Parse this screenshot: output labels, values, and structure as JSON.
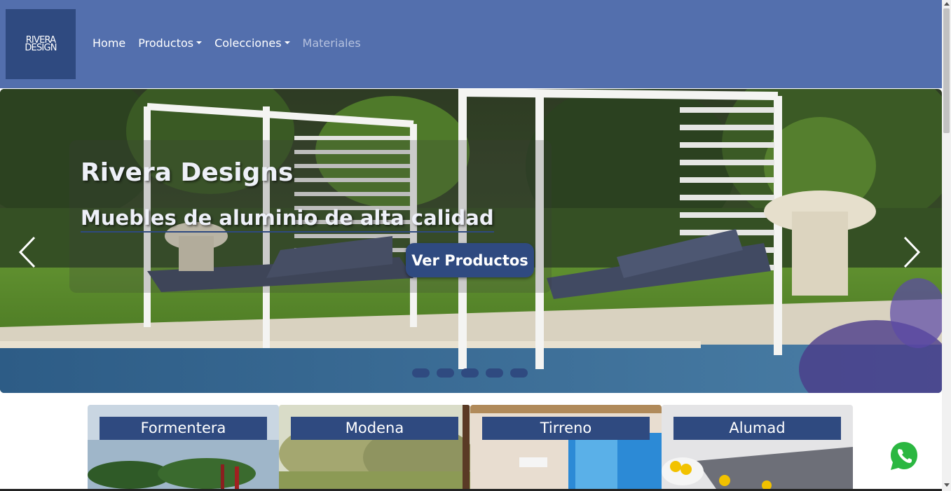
{
  "navbar": {
    "logo": {
      "line1": "RIVERA",
      "line2": "DESIGN"
    },
    "items": [
      {
        "label": "Home",
        "dropdown": false
      },
      {
        "label": "Productos",
        "dropdown": true
      },
      {
        "label": "Colecciones",
        "dropdown": true
      },
      {
        "label": "Materiales",
        "dropdown": false
      }
    ]
  },
  "hero": {
    "title": "Rivera Designs",
    "subtitle": "Muebles de aluminio de alta calidad",
    "button_label": "Ver Productos",
    "slide_count": 5
  },
  "collections": [
    {
      "label": "Formentera"
    },
    {
      "label": "Modena"
    },
    {
      "label": "Tirreno"
    },
    {
      "label": "Alumad"
    }
  ],
  "colors": {
    "brand_primary": "#536fad",
    "brand_dark": "#2f4a80"
  },
  "icons": [
    "chevron-left-icon",
    "chevron-right-icon",
    "whatsapp-icon"
  ]
}
